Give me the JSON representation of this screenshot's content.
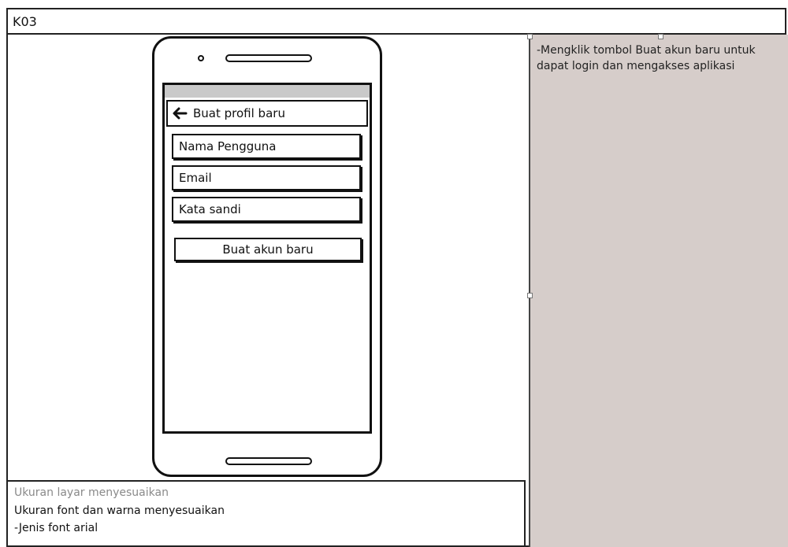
{
  "header": {
    "screen_id": "K03"
  },
  "phone": {
    "appbar_title": "Buat profil baru",
    "fields": [
      {
        "label": "Nama Pengguna"
      },
      {
        "label": "Email"
      },
      {
        "label": "Kata sandi"
      }
    ],
    "submit_label": "Buat akun baru"
  },
  "notes": {
    "description": "-Mengklik tombol Buat akun baru untuk dapat login dan mengakses aplikasi"
  },
  "spec": {
    "line1": "Ukuran layar menyesuaikan",
    "line2": "Ukuran font dan warna menyesuaikan",
    "line3": "-Jenis font arial"
  },
  "colors": {
    "notes_panel": "#d6cdca",
    "status_bar": "#c9c9c9"
  },
  "icons": {
    "back": "arrow-left-icon"
  }
}
